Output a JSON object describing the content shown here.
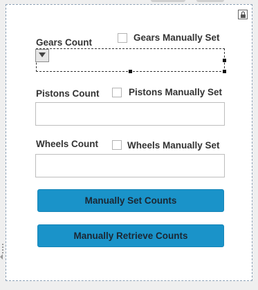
{
  "form": {
    "gears": {
      "label": "Gears Count",
      "checkbox_label": "Gears Manually Set",
      "checked": false,
      "value": ""
    },
    "pistons": {
      "label": "Pistons Count",
      "checkbox_label": "Pistons Manually Set",
      "checked": false,
      "value": ""
    },
    "wheels": {
      "label": "Wheels Count",
      "checkbox_label": "Wheels Manually Set",
      "checked": false,
      "value": ""
    }
  },
  "buttons": {
    "set_label": "Manually Set Counts",
    "retrieve_label": "Manually Retrieve Counts"
  },
  "icons": {
    "lock": "lock-icon",
    "dropdown": "triangle-down-icon",
    "resize": "resize-grip-icon"
  },
  "colors": {
    "button_bg": "#1a93c9",
    "panel_border": "#8a9fb5"
  }
}
